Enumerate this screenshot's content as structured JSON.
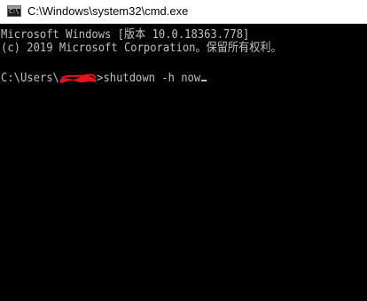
{
  "window": {
    "title": "C:\\Windows\\system32\\cmd.exe",
    "icon": "cmd-app-icon",
    "icon_glyph": "C:\\"
  },
  "console": {
    "line1": "Microsoft Windows [版本 10.0.18363.778]",
    "line2": "(c) 2019 Microsoft Corporation。保留所有权利。",
    "prompt_prefix": "C:\\Users\\",
    "prompt_suffix": ">",
    "command": "shutdown -h now"
  },
  "colors": {
    "console_background": "#000000",
    "console_text": "#c0c0c0",
    "titlebar_background": "#ffffff",
    "redaction": "#e8141c"
  }
}
